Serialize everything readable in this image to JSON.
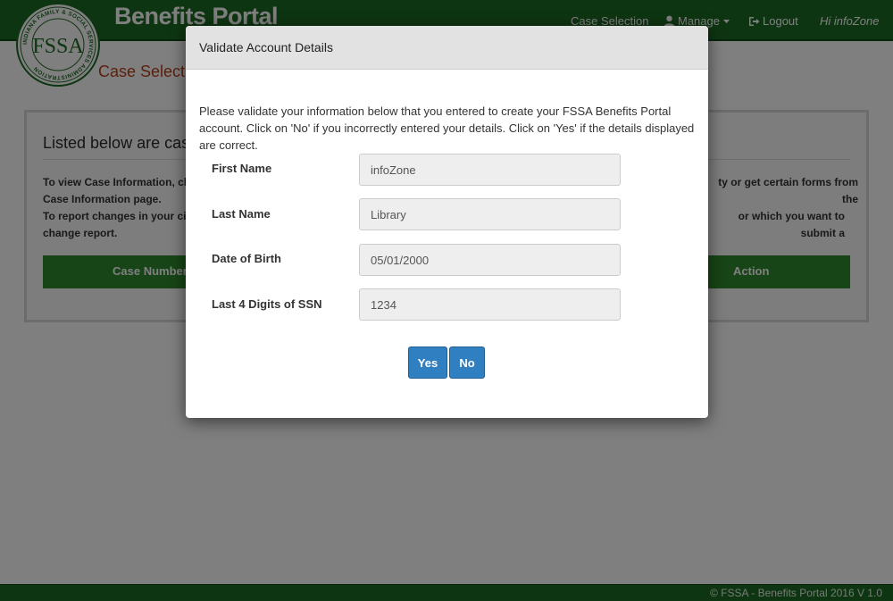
{
  "header": {
    "brand": "Benefits Portal",
    "logo_letters": "FSSA",
    "logo_ring_text": "INDIANA FAMILY & SOCIAL SERVICES ADMINISTRATION",
    "nav": {
      "case_selection": "Case Selection",
      "manage": "Manage",
      "logout": "Logout",
      "greeting": "Hi infoZone"
    }
  },
  "page": {
    "heading": "Case Selectio",
    "panel_title": "Listed below are case",
    "text_line1": "To view Case Information, click",
    "text_line2": "Case Information page.",
    "text_line3": "To report changes in your circu",
    "text_line4": "change report.",
    "text_right1": "ty or get certain forms from the",
    "text_right2": "or which you want to submit a",
    "table_columns": {
      "case_number": "Case Number",
      "action": "Action"
    }
  },
  "modal": {
    "title": "Validate Account Details",
    "intro": "Please validate your information below that you entered to create your FSSA Benefits Portal account. Click on 'No' if you incorrectly entered your details. Click on 'Yes' if the details displayed are correct.",
    "fields": {
      "first_name": {
        "label": "First Name",
        "value": "infoZone"
      },
      "last_name": {
        "label": "Last Name",
        "value": "Library"
      },
      "dob": {
        "label": "Date of Birth",
        "value": "05/01/2000"
      },
      "ssn": {
        "label": "Last 4 Digits of SSN",
        "value": "1234"
      }
    },
    "buttons": {
      "yes": "Yes",
      "no": "No"
    }
  },
  "footer": {
    "text": "© FSSA - Benefits Portal 2016 V 1.0"
  },
  "colors": {
    "header_green": "#1d6b22",
    "table_green": "#2e8a2f",
    "heading_orange": "#b5411b",
    "button_blue": "#2f7fc1"
  },
  "icons": {
    "manage": "user-icon",
    "manage_caret": "caret-down-icon",
    "logout": "logout-icon"
  }
}
